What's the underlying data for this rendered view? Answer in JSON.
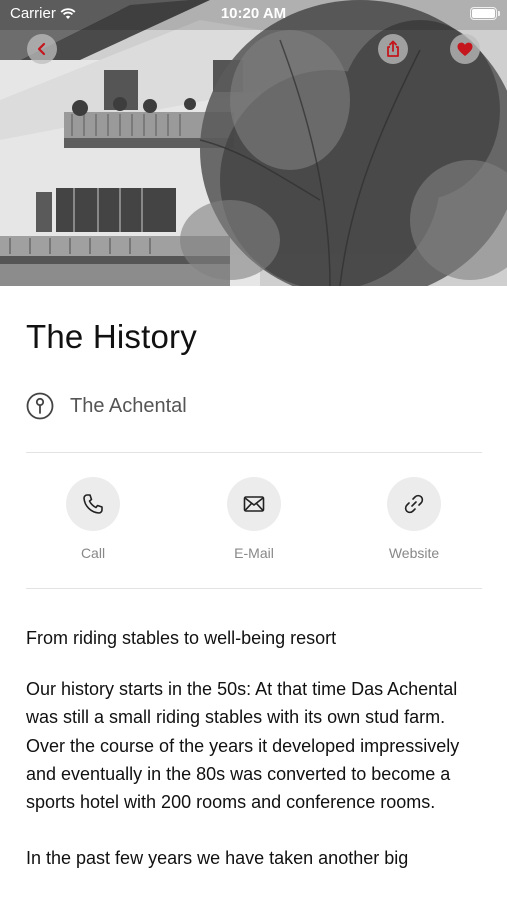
{
  "status_bar": {
    "carrier": "Carrier",
    "time": "10:20 AM"
  },
  "hero": {
    "back_icon": "chevron-left-icon",
    "share_icon": "share-icon",
    "favorite_icon": "heart-icon",
    "accent_color": "#c4161c"
  },
  "page": {
    "title": "The History",
    "location": "The Achental",
    "location_icon": "location-pin-icon"
  },
  "actions": [
    {
      "label": "Call",
      "icon": "phone-icon"
    },
    {
      "label": "E-Mail",
      "icon": "mail-icon"
    },
    {
      "label": "Website",
      "icon": "link-icon"
    }
  ],
  "content": {
    "subtitle": "From riding stables to well-being resort",
    "paragraphs": [
      "Our history starts in the 50s: At that time Das Achental was still a small riding stables with its own stud farm. Over the course of the years it developed impressively and eventually in the 80s was converted to become a sports hotel with 200 rooms and conference rooms.",
      "In the past few years we have taken another big"
    ]
  }
}
